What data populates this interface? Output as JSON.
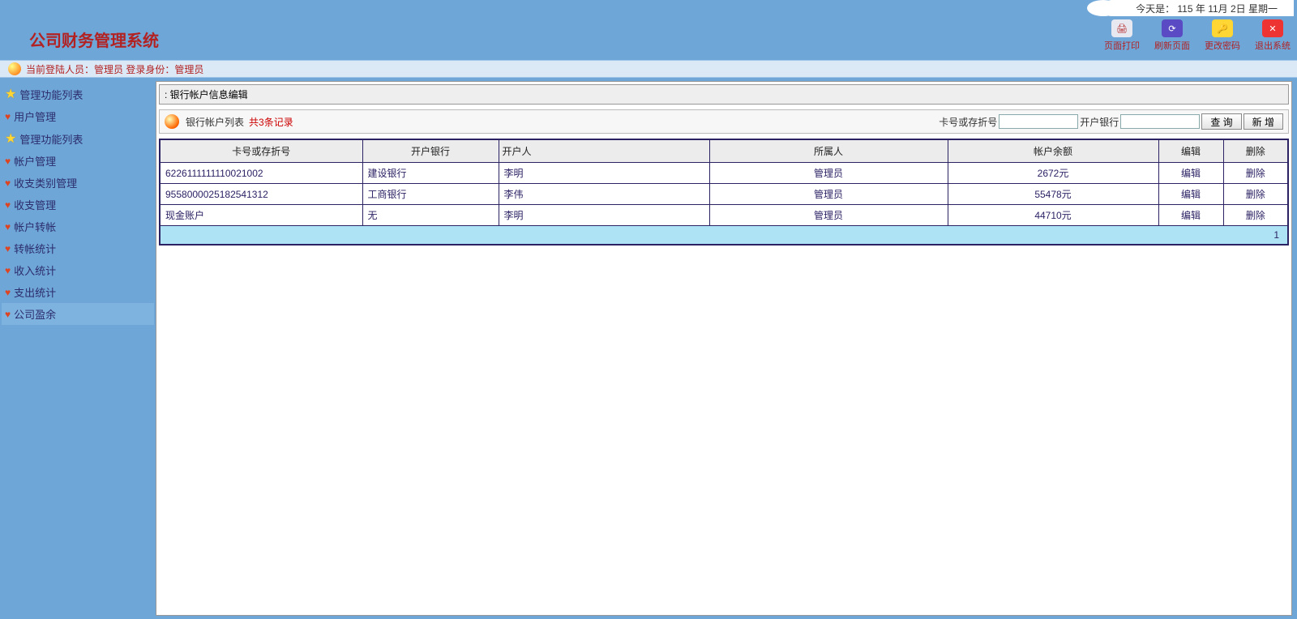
{
  "date_bar": "今天是： 115 年 11月 2日 星期一",
  "app_title": "公司财务管理系统",
  "toolbar": {
    "print": "页面打印",
    "refresh": "刷新页面",
    "password": "更改密码",
    "logout": "退出系统"
  },
  "login_bar": {
    "prefix": "当前登陆人员：",
    "user": "管理员",
    "role_prefix": " 登录身份：",
    "role": "管理员"
  },
  "sidebar": [
    {
      "type": "star",
      "label": "管理功能列表"
    },
    {
      "type": "heart",
      "label": "用户管理"
    },
    {
      "type": "star",
      "label": "管理功能列表"
    },
    {
      "type": "heart",
      "label": "帐户管理"
    },
    {
      "type": "heart",
      "label": "收支类别管理"
    },
    {
      "type": "heart",
      "label": "收支管理"
    },
    {
      "type": "heart",
      "label": "帐户转帐"
    },
    {
      "type": "heart",
      "label": "转帐统计"
    },
    {
      "type": "heart",
      "label": "收入统计"
    },
    {
      "type": "heart",
      "label": "支出统计"
    },
    {
      "type": "heart",
      "label": "公司盈余"
    }
  ],
  "panel": {
    "title": "银行帐户信息编辑",
    "list_title": "银行帐户列表",
    "record_count": "共3条记录",
    "search": {
      "card_label": "卡号或存折号",
      "bank_label": "开户银行",
      "query_btn": "查 询",
      "add_btn": "新 增"
    }
  },
  "table": {
    "headers": [
      "卡号或存折号",
      "开户银行",
      "开户人",
      "所属人",
      "帐户余额",
      "编辑",
      "删除"
    ],
    "rows": [
      {
        "card": "6226111111110021002",
        "bank": "建设银行",
        "opener": "李明",
        "owner": "管理员",
        "balance": "2672元"
      },
      {
        "card": "9558000025182541312",
        "bank": "工商银行",
        "opener": "李伟",
        "owner": "管理员",
        "balance": "55478元"
      },
      {
        "card": "现金账户",
        "bank": "无",
        "opener": "李明",
        "owner": "管理员",
        "balance": "44710元"
      }
    ],
    "edit_label": "编辑",
    "delete_label": "删除",
    "pager": "1"
  }
}
